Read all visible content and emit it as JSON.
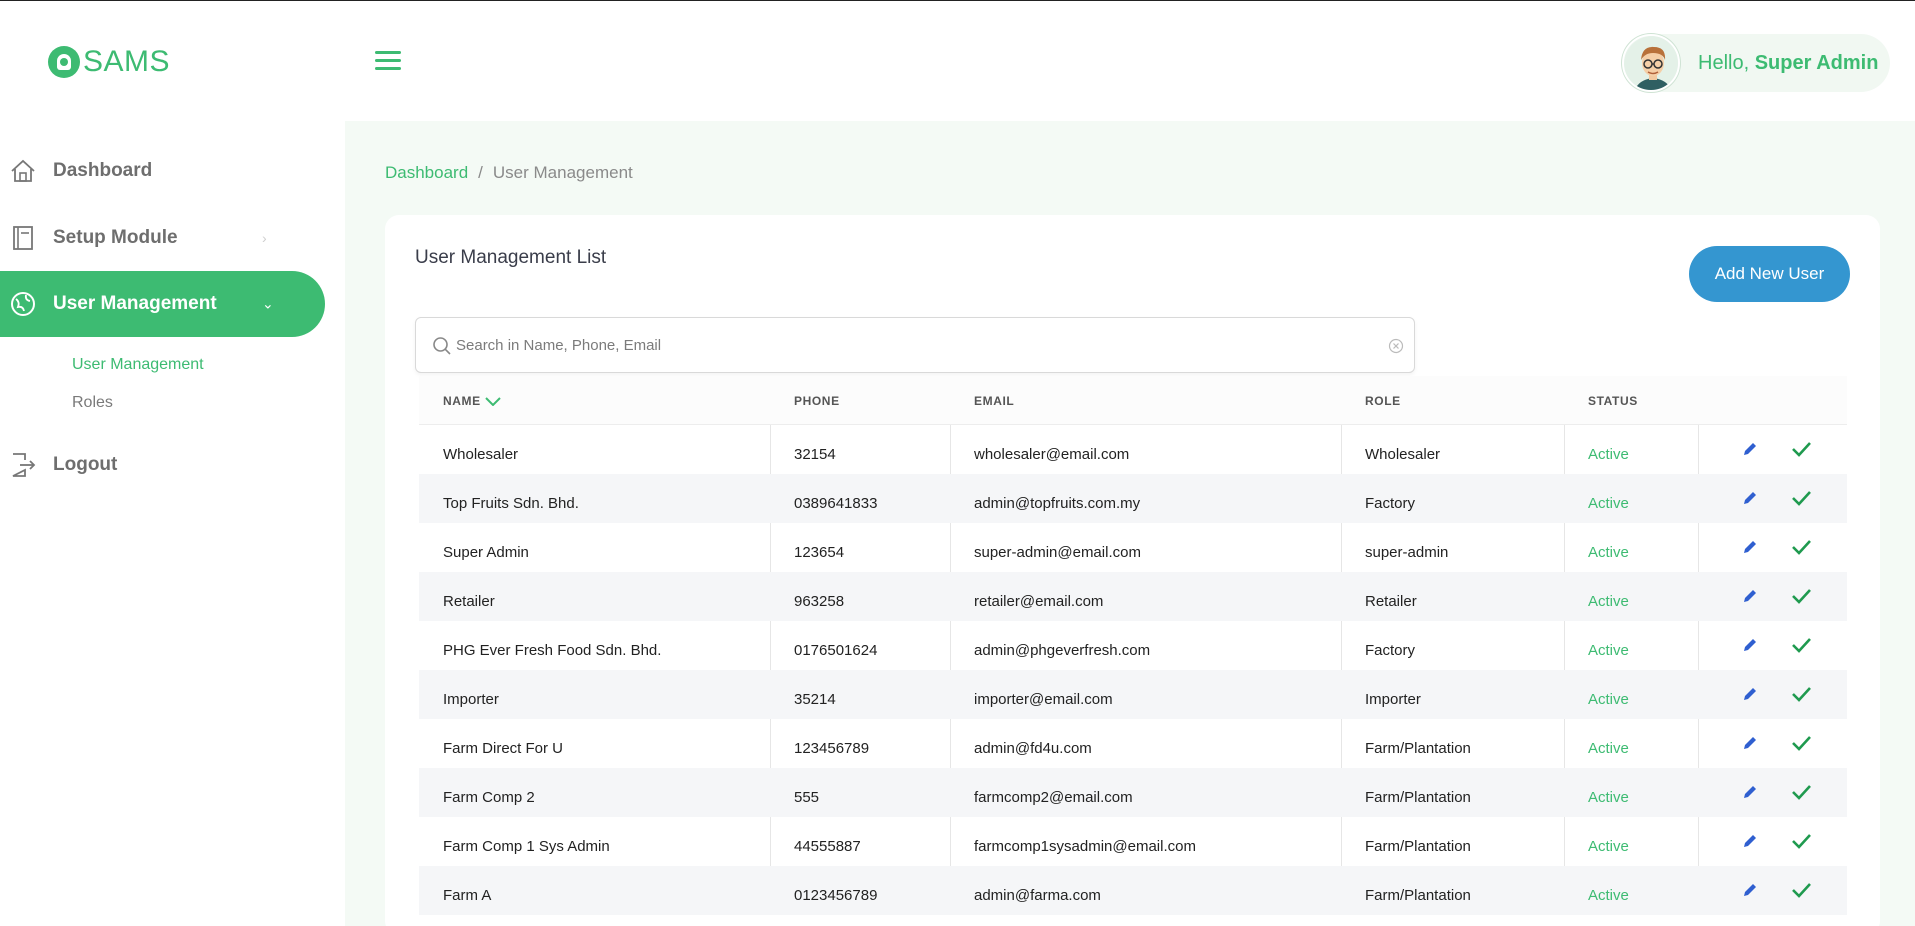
{
  "app": {
    "name": "SAMS"
  },
  "header": {
    "greeting": "Hello,",
    "user_name": "Super Admin"
  },
  "sidebar": {
    "items": [
      {
        "label": "Dashboard",
        "icon": "home-icon"
      },
      {
        "label": "Setup Module",
        "icon": "book-icon",
        "chevron": "›"
      },
      {
        "label": "User Management",
        "icon": "globe-icon",
        "chevron": "⌄",
        "active": true
      },
      {
        "label": "Logout",
        "icon": "logout-icon"
      }
    ],
    "subitems": [
      {
        "label": "User Management",
        "active": true
      },
      {
        "label": "Roles"
      }
    ]
  },
  "breadcrumb": {
    "home": "Dashboard",
    "separator": "/",
    "current": "User Management"
  },
  "card": {
    "title": "User Management List",
    "add_button": "Add New User"
  },
  "search": {
    "placeholder": "Search in Name, Phone, Email"
  },
  "table": {
    "columns": [
      "NAME",
      "PHONE",
      "EMAIL",
      "ROLE",
      "STATUS"
    ],
    "rows": [
      {
        "name": "Wholesaler",
        "phone": "32154",
        "email": "wholesaler@email.com",
        "role": "Wholesaler",
        "status": "Active"
      },
      {
        "name": "Top Fruits Sdn. Bhd.",
        "phone": "0389641833",
        "email": "admin@topfruits.com.my",
        "role": "Factory",
        "status": "Active"
      },
      {
        "name": "Super Admin",
        "phone": "123654",
        "email": "super-admin@email.com",
        "role": "super-admin",
        "status": "Active"
      },
      {
        "name": "Retailer",
        "phone": "963258",
        "email": "retailer@email.com",
        "role": "Retailer",
        "status": "Active"
      },
      {
        "name": "PHG Ever Fresh Food Sdn. Bhd.",
        "phone": "0176501624",
        "email": "admin@phgeverfresh.com",
        "role": "Factory",
        "status": "Active"
      },
      {
        "name": "Importer",
        "phone": "35214",
        "email": "importer@email.com",
        "role": "Importer",
        "status": "Active"
      },
      {
        "name": "Farm Direct For U",
        "phone": "123456789",
        "email": "admin@fd4u.com",
        "role": "Farm/Plantation",
        "status": "Active"
      },
      {
        "name": "Farm Comp 2",
        "phone": "555",
        "email": "farmcomp2@email.com",
        "role": "Farm/Plantation",
        "status": "Active"
      },
      {
        "name": "Farm Comp 1 Sys Admin",
        "phone": "44555887",
        "email": "farmcomp1sysadmin@email.com",
        "role": "Farm/Plantation",
        "status": "Active"
      },
      {
        "name": "Farm A",
        "phone": "0123456789",
        "email": "admin@farma.com",
        "role": "Farm/Plantation",
        "status": "Active"
      }
    ]
  },
  "colors": {
    "brand_green": "#3dbb72",
    "button_blue": "#3496d0",
    "edit_blue": "#2f5fd0"
  }
}
